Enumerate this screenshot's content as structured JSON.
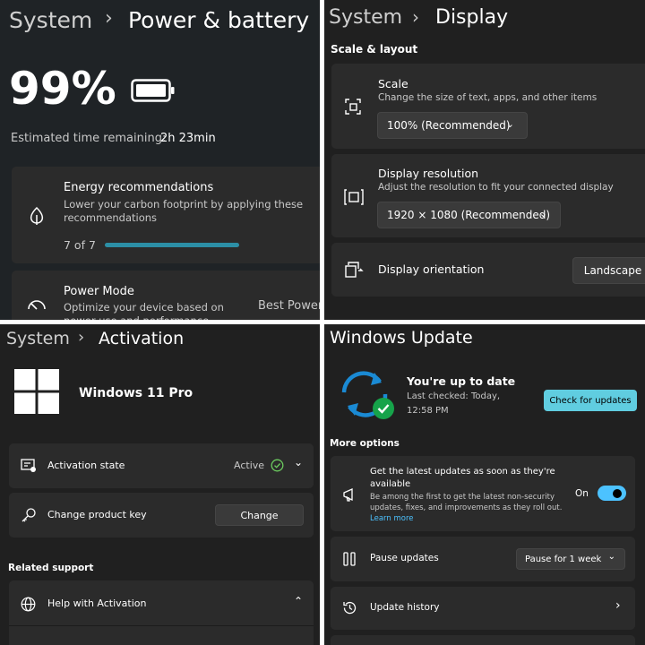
{
  "q1": {
    "crumb_system": "System",
    "crumb_sep": "›",
    "title": "Power & battery",
    "battery_percent": "99%",
    "estimate_label": "Estimated time remaining:",
    "estimate_value": "2h 23min",
    "energy": {
      "title": "Energy recommendations",
      "desc": "Lower your carbon footprint by applying these recommendations",
      "count": "7 of 7",
      "progress_fraction": 1.0
    },
    "power_mode": {
      "title": "Power Mode",
      "desc": "Optimize your device based on power use and performance",
      "value": "Best Power"
    }
  },
  "q2": {
    "crumb_system": "System",
    "crumb_sep": "›",
    "title": "Display",
    "section": "Scale & layout",
    "scale": {
      "title": "Scale",
      "desc": "Change the size of text, apps, and other items",
      "value": "100% (Recommended)"
    },
    "resolution": {
      "title": "Display resolution",
      "desc": "Adjust the resolution to fit your connected display",
      "value": "1920 × 1080 (Recommended)"
    },
    "orientation": {
      "title": "Display orientation",
      "value": "Landscape"
    }
  },
  "q3": {
    "crumb_system": "System",
    "crumb_sep": "›",
    "title": "Activation",
    "edition": "Windows 11 Pro",
    "activation_state": {
      "label": "Activation state",
      "value": "Active"
    },
    "product_key": {
      "label": "Change product key",
      "button": "Change"
    },
    "related": "Related support",
    "help": {
      "label": "Help with Activation"
    }
  },
  "q4": {
    "title": "Windows Update",
    "status_title": "You're up to date",
    "last_checked": "Last checked: Today, 12:58 PM",
    "check_button": "Check for updates",
    "more_options": "More options",
    "latest": {
      "title": "Get the latest updates as soon as they're available",
      "desc": "Be among the first to get the latest non-security updates, fixes, and improvements as they roll out.",
      "link": "Learn more",
      "toggle_label": "On"
    },
    "pause": {
      "label": "Pause updates",
      "value": "Pause for 1 week"
    },
    "history": {
      "label": "Update history"
    }
  },
  "colors": {
    "accent": "#4cc2ff",
    "progress": "#2c8fa6",
    "active_green": "#6ccb5f",
    "check_btn": "#60cde0",
    "sync_blue": "#1a8ad4"
  }
}
